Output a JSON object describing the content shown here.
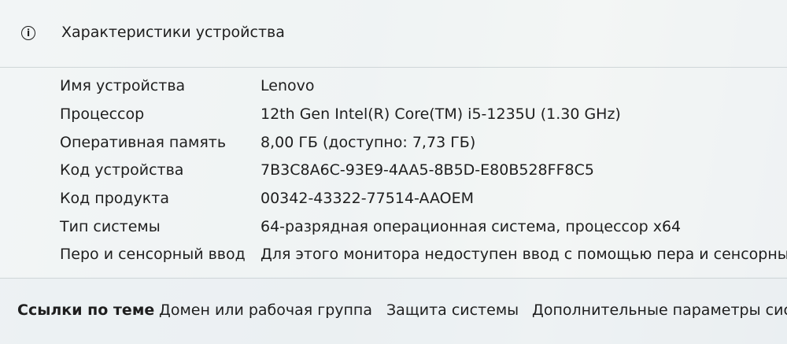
{
  "card": {
    "title": "Характеристики устройства",
    "icon": "info-icon",
    "specs": [
      {
        "label": "Имя устройства",
        "value": "Lenovo"
      },
      {
        "label": "Процессор",
        "value": "12th Gen Intel(R) Core(TM) i5-1235U (1.30 GHz)"
      },
      {
        "label": "Оперативная память",
        "value": "8,00 ГБ (доступно: 7,73 ГБ)"
      },
      {
        "label": "Код устройства",
        "value": "7B3C8A6C-93E9-4AA5-8B5D-E80B528FF8C5"
      },
      {
        "label": "Код продукта",
        "value": "00342-43322-77514-AAOEM"
      },
      {
        "label": "Тип системы",
        "value": "64-разрядная операционная система, процессор x64"
      },
      {
        "label": "Перо и сенсорный ввод",
        "value": "Для этого монитора недоступен ввод с помощью пера и сенсорный в"
      }
    ]
  },
  "links": {
    "heading": "Ссылки по теме",
    "items": [
      {
        "label": "Домен или рабочая группа"
      },
      {
        "label": "Защита системы"
      },
      {
        "label": "Дополнительные параметры сист"
      }
    ]
  }
}
